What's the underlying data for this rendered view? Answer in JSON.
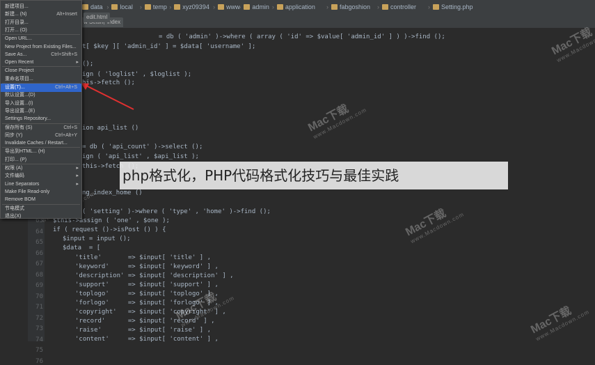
{
  "breadcrumbs": [
    "data",
    "local",
    "temp",
    "xyz09394",
    "www",
    "admin",
    "application",
    "fabgoshion",
    "controller",
    "Setting.php"
  ],
  "editor_tab": {
    "label": "edit.html"
  },
  "sub_tabs": [
    "w Setting",
    "index"
  ],
  "file_menu": {
    "items": [
      {
        "label": "新建项目...",
        "shortcut": ""
      },
      {
        "label": "新建... (N)",
        "shortcut": "Alt+Insert"
      },
      {
        "label": "打开目录...",
        "shortcut": ""
      },
      {
        "label": "打开... (O)",
        "shortcut": ""
      },
      {
        "label": "Open URL...",
        "shortcut": ""
      },
      {
        "label": "New Project from Existing Files...",
        "shortcut": ""
      },
      {
        "label": "Save As...",
        "shortcut": "Ctrl+Shift+S"
      },
      {
        "label": "Open Recent",
        "shortcut": ""
      },
      {
        "label": "Close Project",
        "shortcut": ""
      },
      {
        "label": "重命名项目...",
        "shortcut": ""
      },
      {
        "label": "设置(T)...",
        "shortcut": "Ctrl+Alt+S"
      },
      {
        "label": "默认设置...(D)",
        "shortcut": ""
      },
      {
        "label": "导入设置...(I)",
        "shortcut": ""
      },
      {
        "label": "导出设置...(E)",
        "shortcut": ""
      },
      {
        "label": "Settings Repository...",
        "shortcut": ""
      },
      {
        "label": "保存所有 (S)",
        "shortcut": "Ctrl+S"
      },
      {
        "label": "同步 (Y)",
        "shortcut": "Ctrl+Alt+Y"
      },
      {
        "label": "Invalidate Caches / Restart...",
        "shortcut": ""
      },
      {
        "label": "导出到HTML... (H)",
        "shortcut": ""
      },
      {
        "label": "打印... (P)",
        "shortcut": ""
      },
      {
        "label": "权限 (A)",
        "shortcut": ""
      },
      {
        "label": "文件编码",
        "shortcut": ""
      },
      {
        "label": "Line Separators",
        "shortcut": ""
      },
      {
        "label": "Make File Read-only",
        "shortcut": ""
      },
      {
        "label": "Remove BOM",
        "shortcut": ""
      },
      {
        "label": "节电模式",
        "shortcut": ""
      },
      {
        "label": "退出(X)",
        "shortcut": ""
      }
    ],
    "submenu_indices": [
      7,
      20,
      21,
      22
    ]
  },
  "line_numbers": [
    "63",
    "64",
    "65",
    "66",
    "67",
    "68",
    "69",
    "70",
    "71",
    "72",
    "73",
    "74",
    "75",
    "76"
  ],
  "code_lines": [
    "= db ( 'admin' )->where ( array ( 'id' => $value[ 'admin_id' ] ) )->find ();",
    "t[ $key ][ 'admin_id' ] = $data[ 'username' ];",
    "();",
    "ign ( 'loglist' , $loglist );",
    "his->fetch ();",
    "ion api_list ()",
    "= db ( 'api_count' )->select ();",
    "ign ( 'api_list' , $api_list );",
    "this->fetch ();",
    "ng_index_home ()",
    "( 'setting' )->where ( 'type' , 'home' )->find ();",
    "$this->assign ( 'one' , $one );",
    "if ( request ()->isPost () ) {",
    "$input = input ();",
    "$data  = [",
    "'title'       => $input[ 'title' ] ,",
    "'keyword'     => $input[ 'keyword' ] ,",
    "'description' => $input[ 'description' ] ,",
    "'support'     => $input[ 'support' ] ,",
    "'toplogo'     => $input[ 'toplogo' ] ,",
    "'forlogo'     => $input[ 'forlogo' ] ,",
    "'copyright'   => $input[ 'copyright' ] ,",
    "'record'      => $input[ 'record' ] ,",
    "'raise'       => $input[ 'raise' ] ,",
    "'content'     => $input[ 'content' ] ,"
  ],
  "banner": {
    "text": "php格式化，PHP代码格式化技巧与最佳实践"
  },
  "watermark": {
    "brand": "Mac下载",
    "url": "www.Macdown.com"
  },
  "colors": {
    "menu_selected": "#2f65ca",
    "arrow": "#e03030",
    "editor_bg": "#2b2b2b"
  }
}
